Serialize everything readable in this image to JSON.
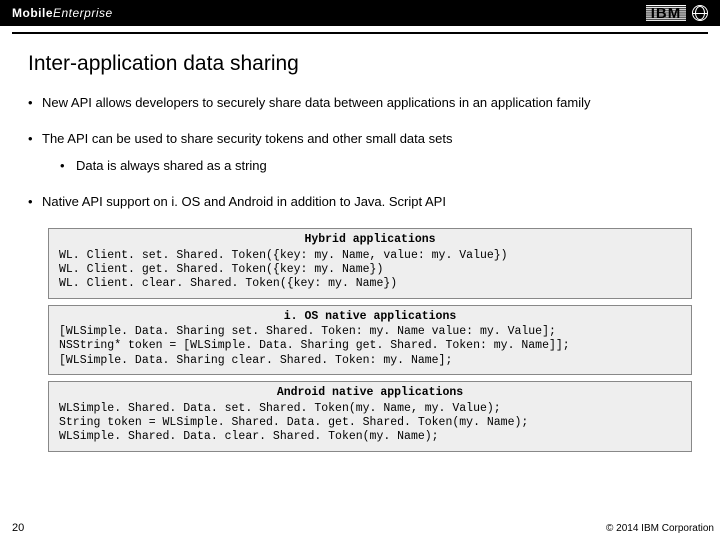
{
  "header": {
    "brand_prefix": "Mobile",
    "brand_suffix": "Enterprise",
    "ibm": "IBM"
  },
  "title": "Inter-application data sharing",
  "bullets": {
    "b1": "New API allows developers to securely share data between applications in an application family",
    "b2": "The API can be used to share security tokens and other small data sets",
    "b2_sub": "Data is always shared as a string",
    "b3": "Native API support on i. OS and Android in addition to Java. Script API"
  },
  "code1": {
    "title": "Hybrid applications",
    "l1": "WL. Client. set. Shared. Token({key: my. Name, value: my. Value})",
    "l2": "WL. Client. get. Shared. Token({key: my. Name})",
    "l3": "WL. Client. clear. Shared. Token({key: my. Name})"
  },
  "code2": {
    "title": "i. OS native applications",
    "l1": "[WLSimple. Data. Sharing set. Shared. Token: my. Name value: my. Value];",
    "l2": "NSString* token = [WLSimple. Data. Sharing get. Shared. Token: my. Name]];",
    "l3": "[WLSimple. Data. Sharing clear. Shared. Token: my. Name];"
  },
  "code3": {
    "title": "Android native applications",
    "l1": "WLSimple. Shared. Data. set. Shared. Token(my. Name, my. Value);",
    "l2": "String token = WLSimple. Shared. Data. get. Shared. Token(my. Name);",
    "l3": "WLSimple. Shared. Data. clear. Shared. Token(my. Name);"
  },
  "footer": {
    "page": "20",
    "copyright": "© 2014 IBM Corporation"
  }
}
